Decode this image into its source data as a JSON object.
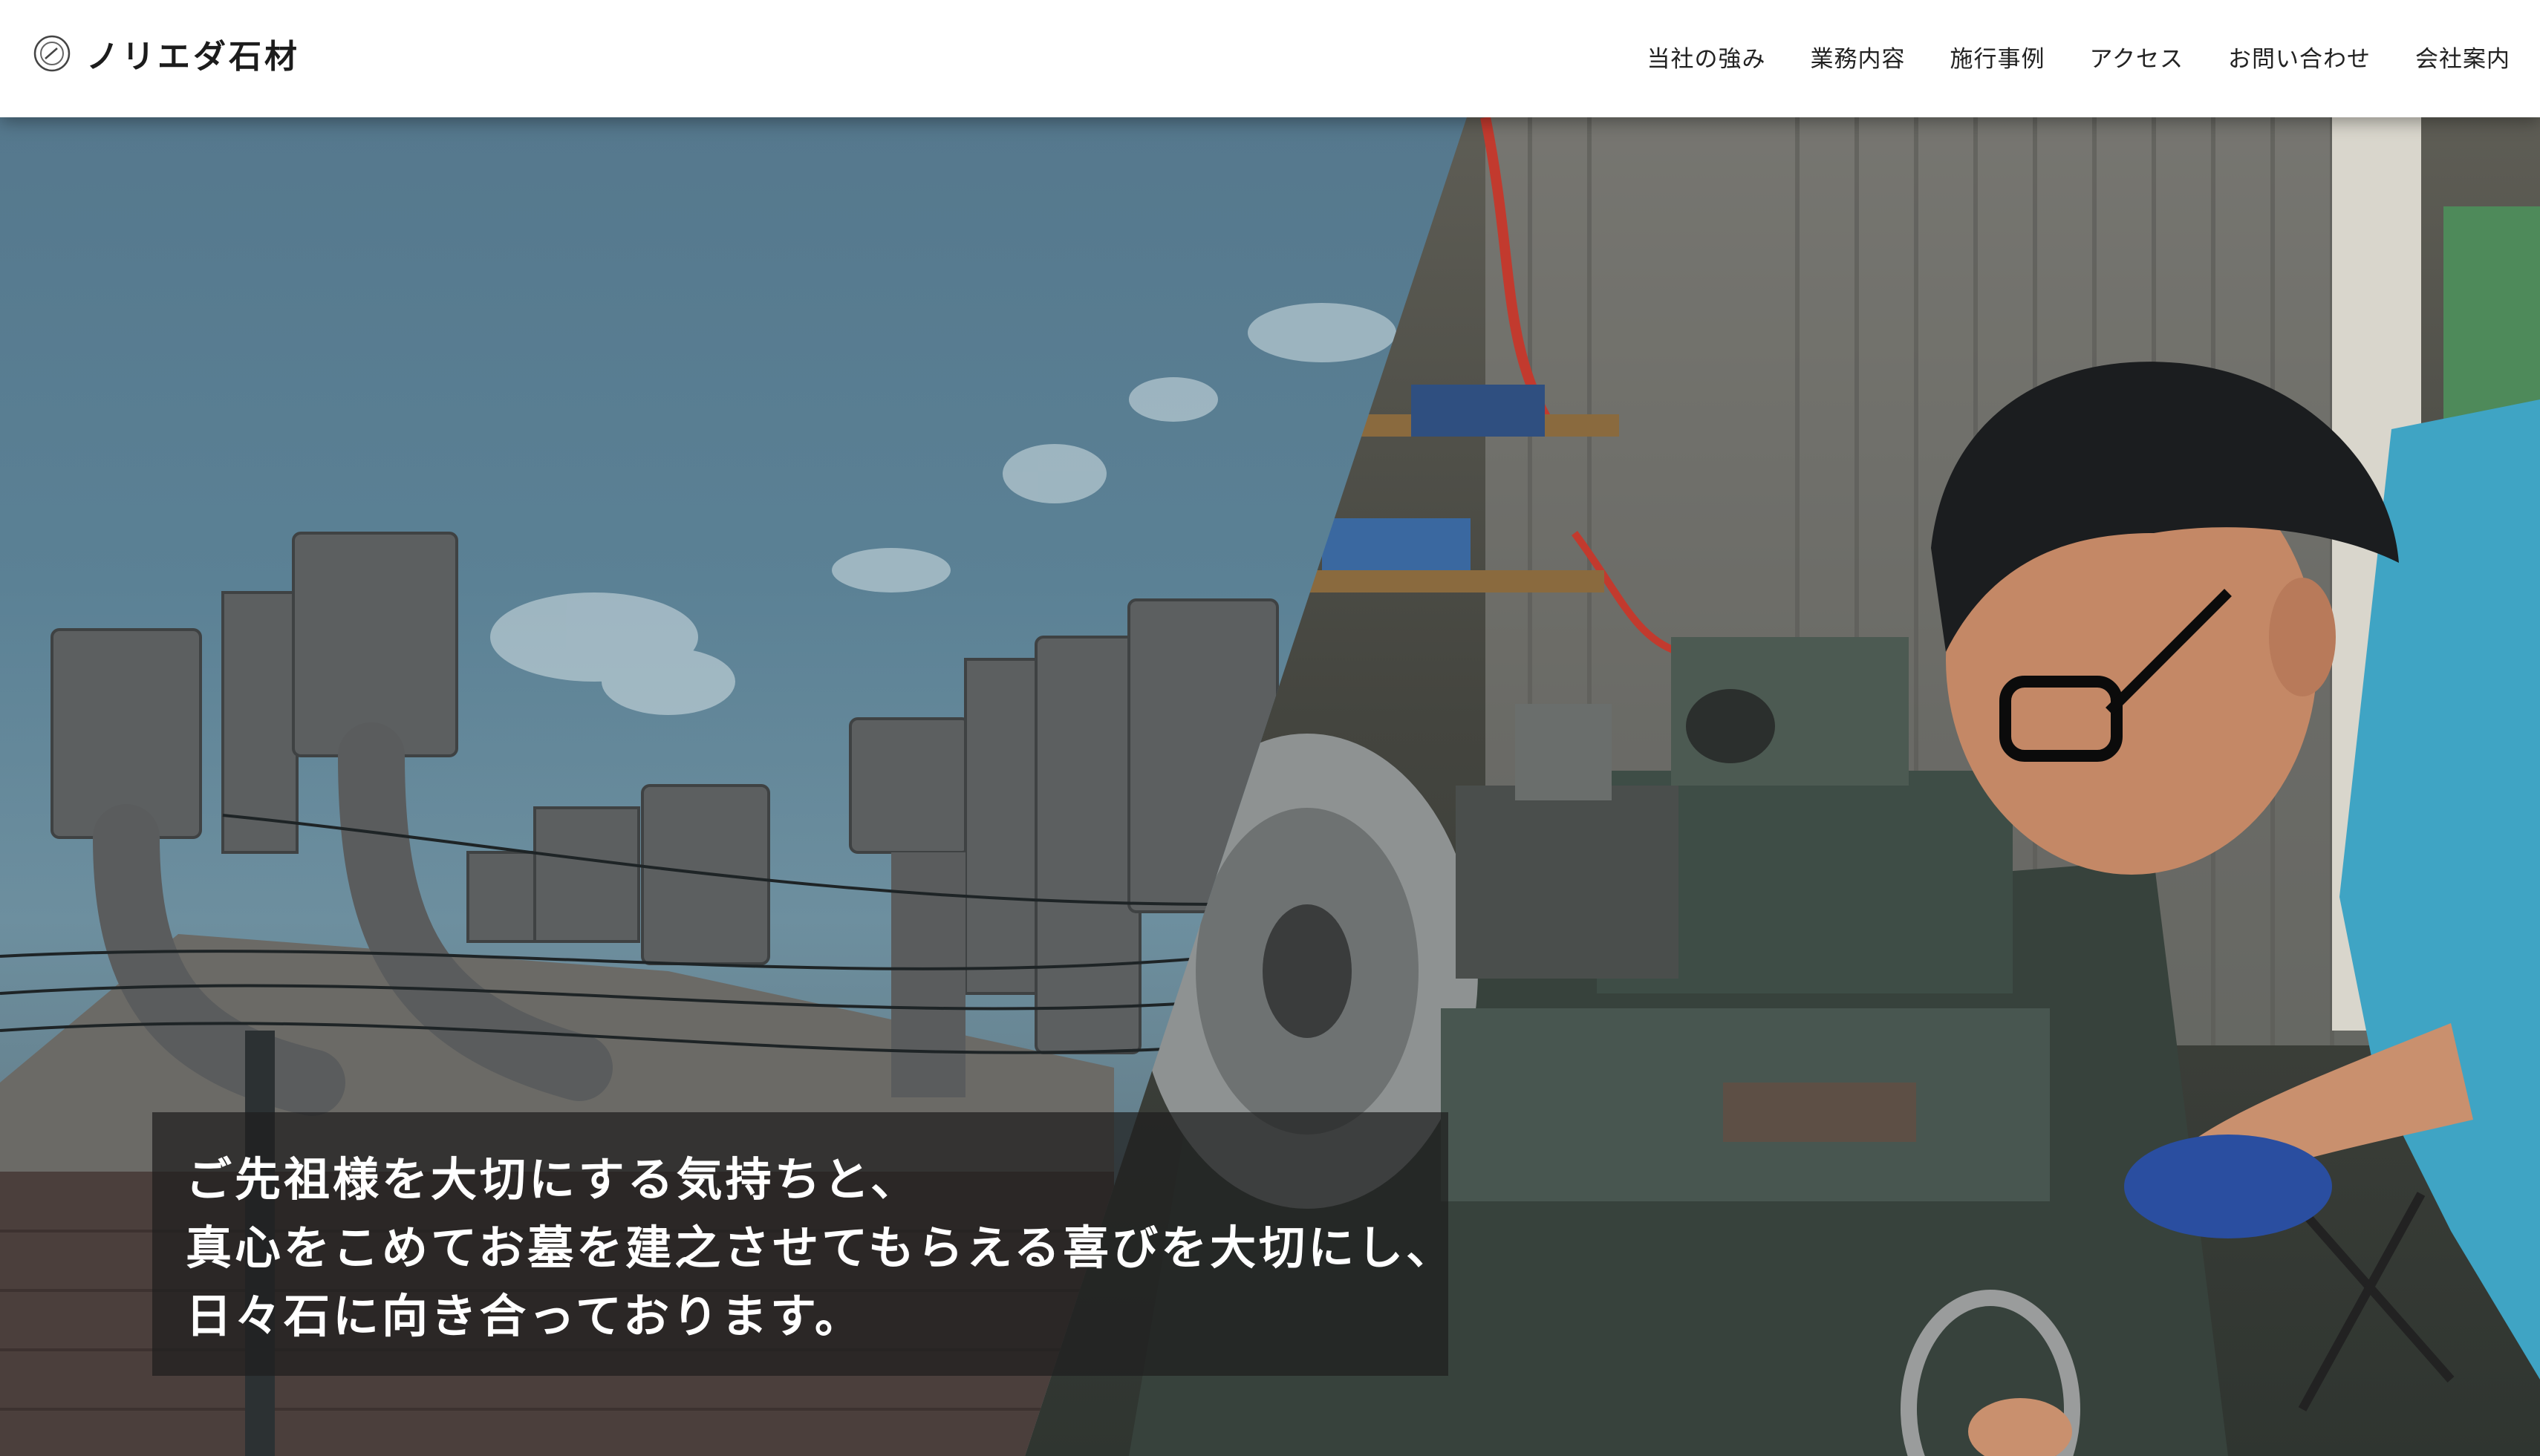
{
  "header": {
    "logo_text": "ノリエダ石材",
    "logo_icon": "stone-mark-icon"
  },
  "nav": {
    "items": [
      {
        "label": "当社の強み"
      },
      {
        "label": "業務内容"
      },
      {
        "label": "施行事例"
      },
      {
        "label": "アクセス"
      },
      {
        "label": "お問い合わせ"
      },
      {
        "label": "会社案内"
      }
    ]
  },
  "hero": {
    "lines": [
      "ご先祖様を大切にする気持ちと、",
      "真心をこめてお墓を建之させてもらえる喜びを大切にし、",
      "日々石に向き合っております。"
    ]
  },
  "colors": {
    "header_bg": "#ffffff",
    "sky": "#5b8195",
    "text_overlay_bg": "#1e1e1e",
    "text_overlay_fg": "#ffffff",
    "shirt": "#3fa4c4"
  }
}
